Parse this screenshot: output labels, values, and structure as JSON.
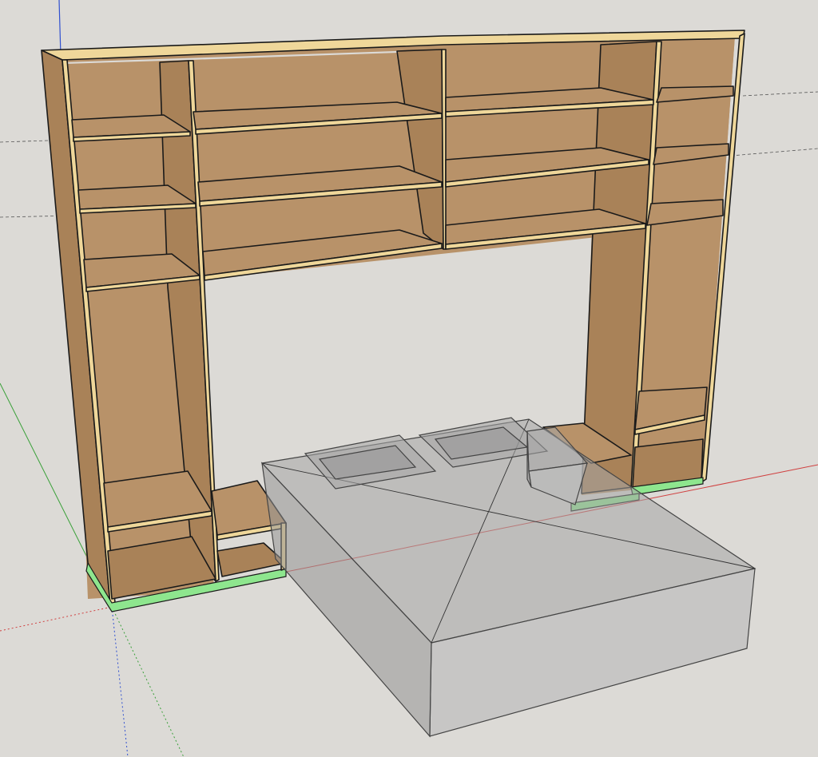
{
  "app": {
    "name": ""
  },
  "scene": {
    "background_color": "#dcdad6",
    "wood_color": "#b89269",
    "wood_edge_color": "#efd79a",
    "plinth_color": "#8ee68e",
    "ghost_color": "#9a9a9a",
    "axis_colors": {
      "red": "#d04040",
      "green": "#3aa03a",
      "blue": "#3050d0"
    }
  },
  "models": {
    "wardrobe": {
      "label": ""
    },
    "bed": {
      "label": ""
    },
    "pillow_left": {
      "label": ""
    },
    "pillow_right": {
      "label": ""
    },
    "nightstand_left": {
      "label": ""
    },
    "nightstand_right": {
      "label": ""
    }
  }
}
